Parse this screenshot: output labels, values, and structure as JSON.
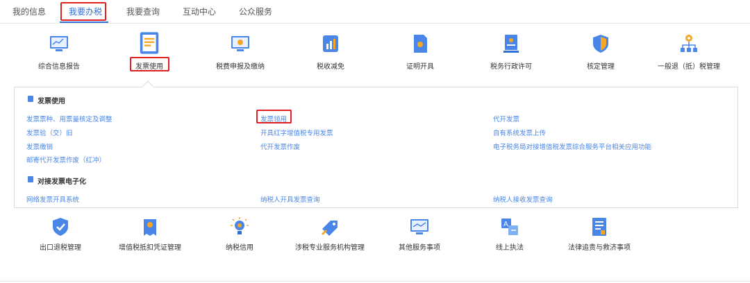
{
  "tabs": [
    "我的信息",
    "我要办税",
    "我要查询",
    "互动中心",
    "公众服务"
  ],
  "row1": [
    "综合信息报告",
    "发票使用",
    "税费申报及缴纳",
    "税收减免",
    "证明开具",
    "税务行政许可",
    "核定管理",
    "一般退（抵）税管理"
  ],
  "row2": [
    "出口退税管理",
    "增值税抵扣凭证管理",
    "纳税信用",
    "涉税专业服务机构管理",
    "其他服务事项",
    "线上执法",
    "法律追责与救济事项"
  ],
  "panel": {
    "section1_title": "发票使用",
    "section1_links": [
      "发票票种、用票量核定及调整",
      "发票验（交）旧",
      "发票缴销",
      "邮寄代开发票作废（红冲）",
      "发票领用",
      "开具红字增值税专用发票",
      "代开发票作废",
      "代开发票",
      "自有系统发票上传",
      "电子税务局对接增值税发票综合服务平台相关应用功能"
    ],
    "section2_title": "对接发票电子化",
    "section2_links": [
      "网络发票开具系统",
      "纳税人开具发票查询",
      "纳税人接收发票查询"
    ]
  },
  "colors": {
    "accent": "#2f6fd6",
    "link": "#4a86e8",
    "highlight": "#e02020"
  }
}
